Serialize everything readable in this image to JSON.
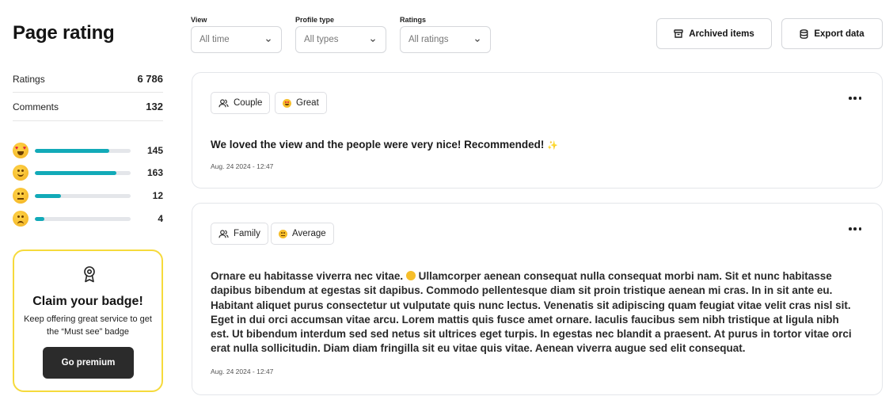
{
  "page": {
    "title": "Page rating"
  },
  "stats": {
    "ratings_label": "Ratings",
    "ratings_value": "6 786",
    "comments_label": "Comments",
    "comments_value": "132"
  },
  "breakdown": [
    {
      "emoji": "heart-eyes-emoji",
      "count": "145",
      "fill": 0.78
    },
    {
      "emoji": "smiling-emoji",
      "count": "163",
      "fill": 0.85
    },
    {
      "emoji": "neutral-emoji",
      "count": "12",
      "fill": 0.27
    },
    {
      "emoji": "confused-emoji",
      "count": "4",
      "fill": 0.1
    }
  ],
  "badge": {
    "icon": "award-icon",
    "title": "Claim your badge!",
    "text": "Keep offering great service to get the “Must see” badge",
    "button": "Go premium"
  },
  "filters": [
    {
      "label": "View",
      "value": "All time"
    },
    {
      "label": "Profile type",
      "value": "All types"
    },
    {
      "label": "Ratings",
      "value": "All ratings"
    }
  ],
  "actions": {
    "archived": "Archived items",
    "export": "Export data"
  },
  "reviews": [
    {
      "profile": "Couple",
      "rating": "Great",
      "text": "We loved the view and the people were very nice! Recommended!",
      "date": "Aug. 24 2024 - 12:47"
    },
    {
      "profile": "Family",
      "rating": "Average",
      "text_start": "Ornare eu habitasse viverra nec vitae.",
      "text_rest": "Ullamcorper aenean consequat nulla consequat morbi nam. Sit et nunc habitasse dapibus bibendum at egestas sit dapibus. Commodo pellentesque diam sit proin tristique aenean mi cras. In in sit ante eu. Habitant aliquet purus consectetur ut vulputate quis nunc lectus. Venenatis sit adipiscing quam feugiat vitae velit cras nisl sit. Eget in dui orci accumsan vitae arcu. Lorem mattis quis fusce amet ornare. Iaculis faucibus sem nibh tristique at ligula nibh est. Ut bibendum interdum sed sed netus sit ultrices eget turpis. In egestas nec blandit a praesent. At purus in tortor vitae orci erat nulla sollicitudin. Diam diam fringilla sit eu vitae quis vitae. Aenean viverra augue sed elit consequat.",
      "date": "Aug. 24 2024 - 12:47"
    }
  ],
  "colors": {
    "accent": "#12aab8",
    "badge_border": "#f6da3c",
    "button_dark": "#2b2b2b"
  }
}
